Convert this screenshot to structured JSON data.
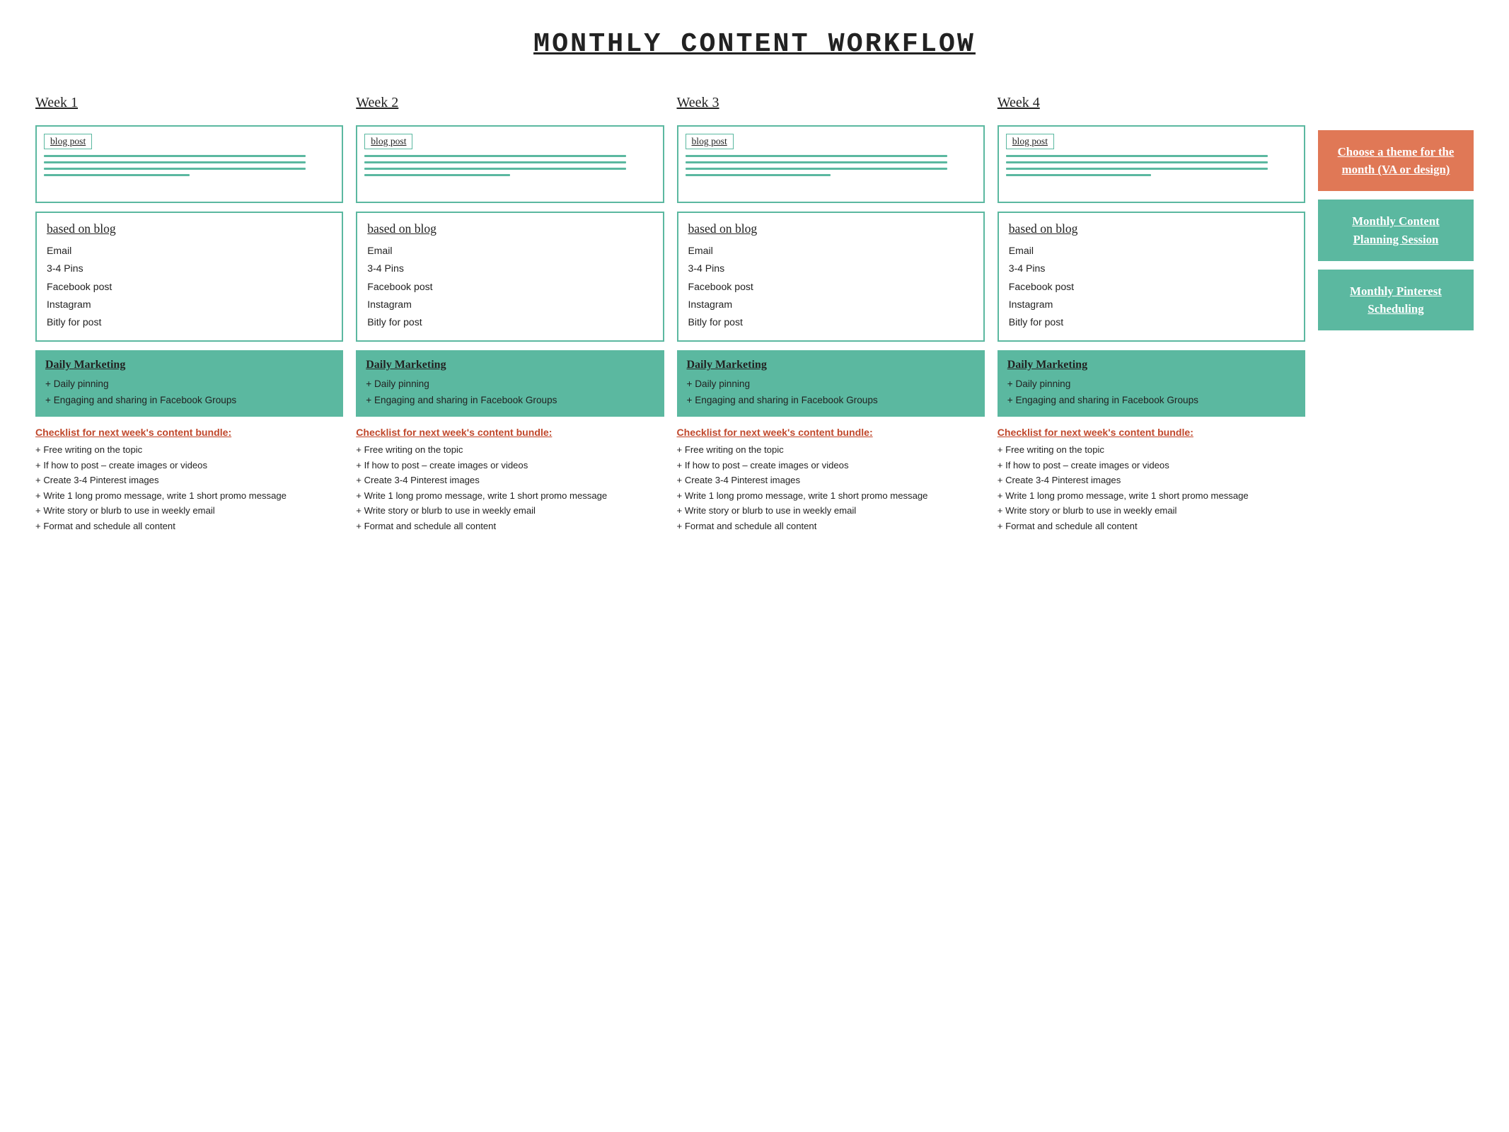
{
  "title": "Monthly Content Workflow",
  "weeks": [
    {
      "heading": "Week 1",
      "blog_label": "blog post",
      "based_title": "based on blog",
      "based_items": [
        "Email",
        "3-4 Pins",
        "Facebook post",
        "Instagram",
        "Bitly for post"
      ],
      "daily_title": "Daily Marketing",
      "daily_items": [
        "Daily pinning",
        "Engaging and sharing in Facebook Groups"
      ],
      "checklist_title": "Checklist for next week's content bundle:",
      "checklist_items": [
        "Free writing on the topic",
        "If how to post – create images or videos",
        "Create 3-4 Pinterest images",
        "Write 1 long promo message, write 1 short promo message",
        "Write story or blurb to use in weekly email",
        "Format and schedule all content"
      ]
    },
    {
      "heading": "Week 2",
      "blog_label": "blog post",
      "based_title": "based on blog",
      "based_items": [
        "Email",
        "3-4 Pins",
        "Facebook post",
        "Instagram",
        "Bitly for post"
      ],
      "daily_title": "Daily Marketing",
      "daily_items": [
        "Daily pinning",
        "Engaging and sharing in Facebook Groups"
      ],
      "checklist_title": "Checklist for next week's content bundle:",
      "checklist_items": [
        "Free writing on the topic",
        "If how to post – create images or videos",
        "Create 3-4 Pinterest images",
        "Write 1 long promo message, write 1 short promo message",
        "Write story or blurb to use in weekly email",
        "Format and schedule all content"
      ]
    },
    {
      "heading": "Week 3",
      "blog_label": "blog post",
      "based_title": "based on blog",
      "based_items": [
        "Email",
        "3-4 Pins",
        "Facebook post",
        "Instagram",
        "Bitly for post"
      ],
      "daily_title": "Daily Marketing",
      "daily_items": [
        "Daily pinning",
        "Engaging and sharing in Facebook Groups"
      ],
      "checklist_title": "Checklist for next week's content bundle:",
      "checklist_items": [
        "Free writing on the topic",
        "If how to post – create images or videos",
        "Create 3-4 Pinterest images",
        "Write 1 long promo message, write 1 short promo message",
        "Write story or blurb to use in weekly email",
        "Format and schedule all content"
      ]
    },
    {
      "heading": "Week 4",
      "blog_label": "blog post",
      "based_title": "based on blog",
      "based_items": [
        "Email",
        "3-4 Pins",
        "Facebook post",
        "Instagram",
        "Bitly for post"
      ],
      "daily_title": "Daily Marketing",
      "daily_items": [
        "Daily pinning",
        "Engaging and sharing in Facebook Groups"
      ],
      "checklist_title": "Checklist for next week's content bundle:",
      "checklist_items": [
        "Free writing on the topic",
        "If how to post – create images or videos",
        "Create 3-4 Pinterest images",
        "Write 1 long promo message, write 1 short promo message",
        "Write story or blurb to use in weekly email",
        "Format and schedule all content"
      ]
    }
  ],
  "sidebar": {
    "card1": "Choose a theme for the month (VA or design)",
    "card2": "Monthly Content Planning Session",
    "card3": "Monthly Pinterest Scheduling"
  }
}
